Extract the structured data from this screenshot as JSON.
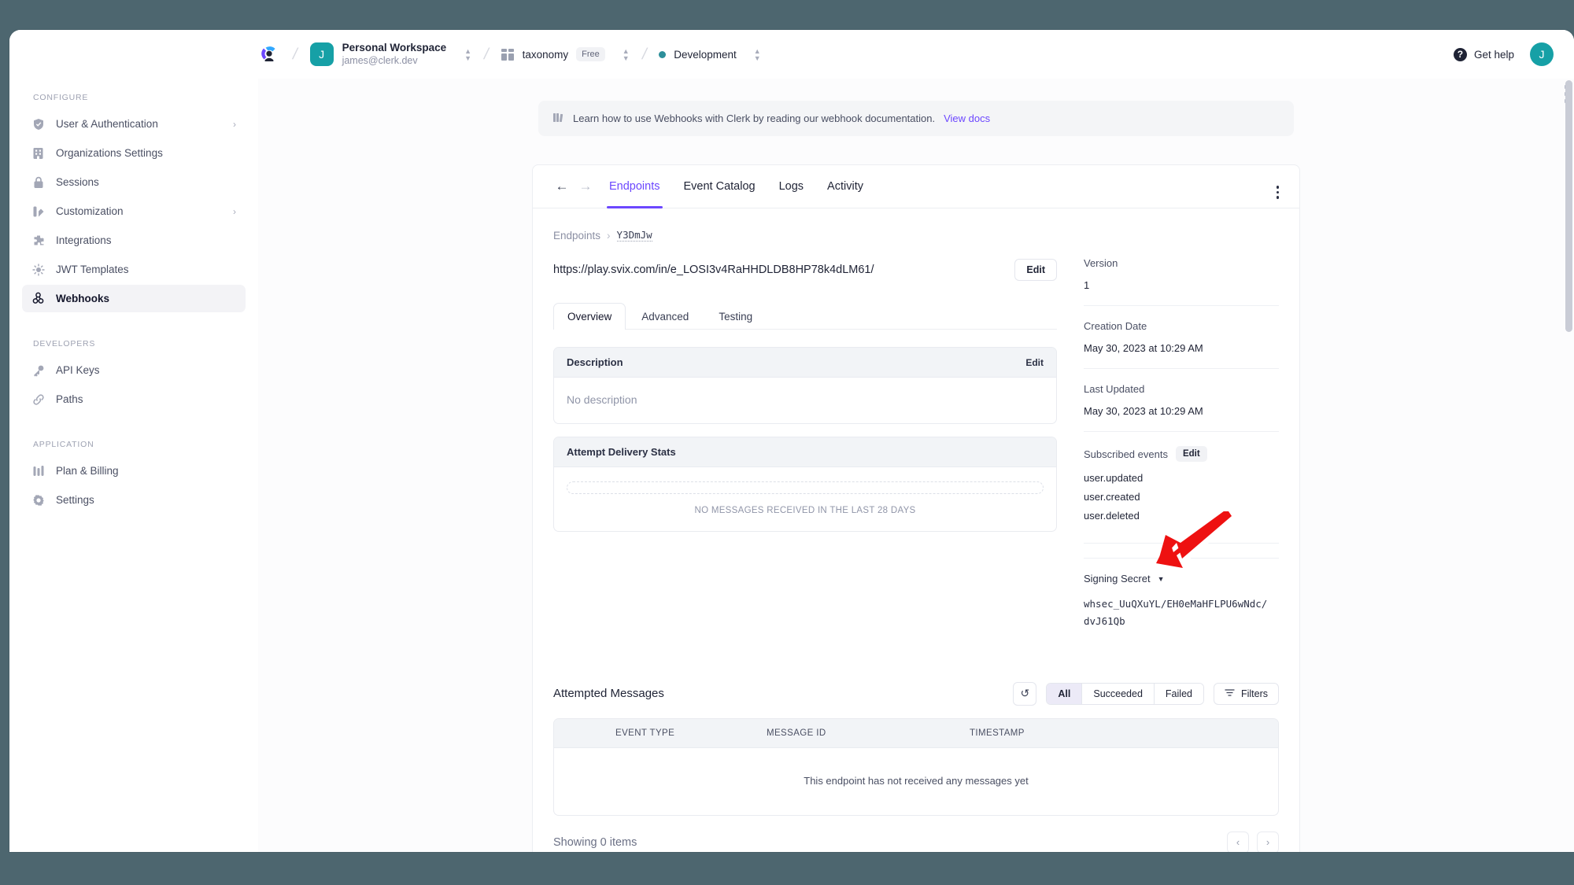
{
  "topbar": {
    "logo_icon": "clerk-logo",
    "workspace": {
      "avatar_letter": "J",
      "name": "Personal Workspace",
      "email": "james@clerk.dev"
    },
    "application": {
      "icon": "app-grid-icon",
      "name": "taxonomy",
      "plan_badge": "Free"
    },
    "environment": {
      "name": "Development",
      "dot_color": "#2d8f9a"
    },
    "help_label": "Get help",
    "user_avatar_letter": "J",
    "accent_teal": "#16a0a6"
  },
  "sidebar": {
    "sections": [
      {
        "title": "CONFIGURE",
        "items": [
          {
            "label": "User & Authentication",
            "icon": "shield-icon",
            "has_chevron": true,
            "active": false
          },
          {
            "label": "Organizations Settings",
            "icon": "building-icon",
            "has_chevron": false,
            "active": false
          },
          {
            "label": "Sessions",
            "icon": "lock-icon",
            "has_chevron": false,
            "active": false
          },
          {
            "label": "Customization",
            "icon": "palette-icon",
            "has_chevron": true,
            "active": false
          },
          {
            "label": "Integrations",
            "icon": "puzzle-icon",
            "has_chevron": false,
            "active": false
          },
          {
            "label": "JWT Templates",
            "icon": "sparkle-icon",
            "has_chevron": false,
            "active": false
          },
          {
            "label": "Webhooks",
            "icon": "webhook-icon",
            "has_chevron": false,
            "active": true
          }
        ]
      },
      {
        "title": "DEVELOPERS",
        "items": [
          {
            "label": "API Keys",
            "icon": "key-icon",
            "has_chevron": false,
            "active": false
          },
          {
            "label": "Paths",
            "icon": "link-icon",
            "has_chevron": false,
            "active": false
          }
        ]
      },
      {
        "title": "APPLICATION",
        "items": [
          {
            "label": "Plan & Billing",
            "icon": "bars-icon",
            "has_chevron": false,
            "active": false
          },
          {
            "label": "Settings",
            "icon": "gear-icon",
            "has_chevron": false,
            "active": false
          }
        ]
      }
    ]
  },
  "notice": {
    "icon": "book-icon",
    "text": "Learn how to use Webhooks with Clerk by reading our webhook documentation.",
    "link_label": "View docs",
    "link_color": "#6c47ff"
  },
  "panel": {
    "back_arrow": "arrow-left-icon",
    "forward_arrow": "arrow-right-icon",
    "tabs": [
      {
        "label": "Endpoints",
        "active": true
      },
      {
        "label": "Event Catalog",
        "active": false
      },
      {
        "label": "Logs",
        "active": false
      },
      {
        "label": "Activity",
        "active": false
      }
    ],
    "accent": "#6c47ff"
  },
  "endpoint": {
    "breadcrumb": {
      "root": "Endpoints",
      "separator": "›",
      "current": "Y3DmJw"
    },
    "url": "https://play.svix.com/in/e_LOSI3v4RaHHDLDB8HP78k4dLM61/",
    "edit_button": "Edit",
    "kebab_icon": "more-vertical-icon",
    "subtabs": [
      {
        "label": "Overview",
        "active": true
      },
      {
        "label": "Advanced",
        "active": false
      },
      {
        "label": "Testing",
        "active": false
      }
    ],
    "description_card": {
      "title": "Description",
      "edit_label": "Edit",
      "body": "No description"
    },
    "stats_card": {
      "title": "Attempt Delivery Stats",
      "empty_note": "NO MESSAGES RECEIVED IN THE LAST 28 DAYS"
    }
  },
  "meta": {
    "version_label": "Version",
    "version_value": "1",
    "creation_label": "Creation Date",
    "creation_value": "May 30, 2023 at 10:29 AM",
    "updated_label": "Last Updated",
    "updated_value": "May 30, 2023 at 10:29 AM",
    "events_label": "Subscribed events",
    "events_edit": "Edit",
    "events": [
      "user.updated",
      "user.created",
      "user.deleted"
    ],
    "secret_label": "Signing Secret",
    "secret_caret": "chevron-down-icon",
    "secret_value": "whsec_UuQXuYL/EH0eMaHFLPU6wNdc/dvJ61Qb"
  },
  "attempted": {
    "title": "Attempted Messages",
    "refresh_icon": "refresh-icon",
    "segments": [
      {
        "label": "All",
        "active": true
      },
      {
        "label": "Succeeded",
        "active": false
      },
      {
        "label": "Failed",
        "active": false
      }
    ],
    "filters_label": "Filters",
    "filters_icon": "filter-icon",
    "columns": [
      "EVENT TYPE",
      "MESSAGE ID",
      "TIMESTAMP"
    ],
    "empty_message": "This endpoint has not received any messages yet",
    "showing": "Showing 0 items",
    "prev_icon": "chevron-left-icon",
    "next_icon": "chevron-right-icon"
  },
  "annotation": {
    "arrow_color": "#ee1111",
    "arrow_outline": "#ffffff"
  }
}
